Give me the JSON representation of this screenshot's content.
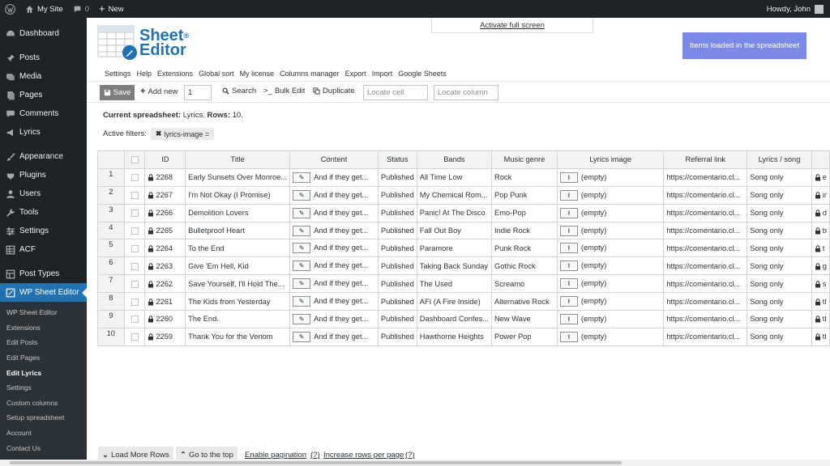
{
  "adminbar": {
    "site_name": "My Site",
    "comments_count": "0",
    "new_label": "New",
    "greeting": "Howdy, John"
  },
  "sidebar": {
    "items": [
      {
        "label": "Dashboard",
        "icon": "dashboard-icon"
      },
      {
        "label": "Posts",
        "icon": "pin-icon"
      },
      {
        "label": "Media",
        "icon": "media-icon"
      },
      {
        "label": "Pages",
        "icon": "pages-icon"
      },
      {
        "label": "Comments",
        "icon": "comments-icon"
      },
      {
        "label": "Lyrics",
        "icon": "megaphone-icon"
      },
      {
        "label": "Appearance",
        "icon": "brush-icon"
      },
      {
        "label": "Plugins",
        "icon": "plugin-icon"
      },
      {
        "label": "Users",
        "icon": "user-icon"
      },
      {
        "label": "Tools",
        "icon": "wrench-icon"
      },
      {
        "label": "Settings",
        "icon": "settings-icon"
      },
      {
        "label": "ACF",
        "icon": "grid-icon"
      },
      {
        "label": "Post Types",
        "icon": "post-types-icon"
      },
      {
        "label": "WP Sheet Editor",
        "icon": "sheet-editor-icon"
      }
    ],
    "submenu": [
      "WP Sheet Editor",
      "Extensions",
      "Edit Posts",
      "Edit Pages",
      "Edit Lyrics",
      "Settings",
      "Custom columns",
      "Setup spreadsheet",
      "Account",
      "Contact Us"
    ]
  },
  "header": {
    "logo_line1": "Sheet",
    "logo_line2": "Editor",
    "logo_reg": "®",
    "fullscreen_label": "Activate full screen",
    "loaded_label": "Items loaded in the spreadsheet"
  },
  "topnav": [
    "Settings",
    "Help",
    "Extensions",
    "Global sort",
    "My license",
    "Columns manager",
    "Export",
    "Import",
    "Google Sheets"
  ],
  "toolbar": {
    "save_label": "Save",
    "add_new_label": "Add new",
    "add_new_count": "1",
    "search_label": "Search",
    "bulk_edit_label": "Bulk Edit",
    "duplicate_label": "Duplicate",
    "locate_cell_placeholder": "Locate cell",
    "locate_column_placeholder": "Locate column"
  },
  "status": {
    "prefix": "Current spreadsheet:",
    "sheet_name": "Lyrics.",
    "rows_label": "Rows:",
    "rows_count": "10."
  },
  "filters": {
    "label": "Active filters:",
    "chip": "lyrics-image ="
  },
  "grid": {
    "columns": [
      "",
      "ID",
      "Title",
      "Content",
      "Status",
      "Bands",
      "Music genre",
      "Lyrics image",
      "Referral link",
      "Lyrics / song"
    ],
    "rows": [
      {
        "num": "1",
        "id": "2268",
        "title": "Early Sunsets Over Monroe...",
        "content": "And if they get...",
        "status": "Published",
        "band": "All Time Low",
        "genre": "Rock",
        "image": "(empty)",
        "link": "https://comentario.cl...",
        "lyrics": "Song only",
        "extra": "e"
      },
      {
        "num": "2",
        "id": "2267",
        "title": "I'm Not Okay (I Promise)",
        "content": "And if they get...",
        "status": "Published",
        "band": "My Chemical Rom...",
        "genre": "Pop Punk",
        "image": "(empty)",
        "link": "https://comentario.cl...",
        "lyrics": "Song only",
        "extra": "ir"
      },
      {
        "num": "3",
        "id": "2266",
        "title": "Demolition Lovers",
        "content": "And if they get...",
        "status": "Published",
        "band": "Panic! At The Disco",
        "genre": "Emo-Pop",
        "image": "(empty)",
        "link": "https://comentario.cl...",
        "lyrics": "Song only",
        "extra": "d"
      },
      {
        "num": "4",
        "id": "2265",
        "title": "Bulletproof Heart",
        "content": "And if they get...",
        "status": "Published",
        "band": "Fall Out Boy",
        "genre": "Indie Rock",
        "image": "(empty)",
        "link": "https://comentario.cl...",
        "lyrics": "Song only",
        "extra": "b"
      },
      {
        "num": "5",
        "id": "2264",
        "title": "To the End",
        "content": "And if they get...",
        "status": "Published",
        "band": "Paramore",
        "genre": "Punk Rock",
        "image": "(empty)",
        "link": "https://comentario.cl...",
        "lyrics": "Song only",
        "extra": "t"
      },
      {
        "num": "6",
        "id": "2263",
        "title": "Give 'Em Hell, Kid",
        "content": "And if they get...",
        "status": "Published",
        "band": "Taking Back Sunday",
        "genre": "Gothic Rock",
        "image": "(empty)",
        "link": "https://comentario.cl...",
        "lyrics": "Song only",
        "extra": "g"
      },
      {
        "num": "7",
        "id": "2262",
        "title": "Save Yourself, I'll Hold The...",
        "content": "And if they get...",
        "status": "Published",
        "band": "The Used",
        "genre": "Screamo",
        "image": "(empty)",
        "link": "https://comentario.cl...",
        "lyrics": "Song only",
        "extra": "s"
      },
      {
        "num": "8",
        "id": "2261",
        "title": "The Kids from Yesterday",
        "content": "And if they get...",
        "status": "Published",
        "band": "AFI (A Fire Inside)",
        "genre": "Alternative Rock",
        "image": "(empty)",
        "link": "https://comentario.cl...",
        "lyrics": "Song only",
        "extra": "tl"
      },
      {
        "num": "9",
        "id": "2260",
        "title": "The End.",
        "content": "And if they get...",
        "status": "Published",
        "band": "Dashboard Confes...",
        "genre": "New Wave",
        "image": "(empty)",
        "link": "https://comentario.cl...",
        "lyrics": "Song only",
        "extra": "tl"
      },
      {
        "num": "10",
        "id": "2259",
        "title": "Thank You for the Venom",
        "content": "And if they get...",
        "status": "Published",
        "band": "Hawthorne Heights",
        "genre": "Power Pop",
        "image": "(empty)",
        "link": "https://comentario.cl...",
        "lyrics": "Song only",
        "extra": "tl"
      }
    ]
  },
  "bottom": {
    "load_more": "Load More Rows",
    "go_top": "Go to the top",
    "enable_pagination": "Enable pagination",
    "help1": "(?)",
    "increase_rows": "Increase rows per page",
    "help2": "(?)"
  },
  "colors": {
    "admin_dark": "#1d2327",
    "accent": "#2271b1",
    "loaded_box": "#7b8ae6",
    "save_button": "#7d7d7d"
  }
}
